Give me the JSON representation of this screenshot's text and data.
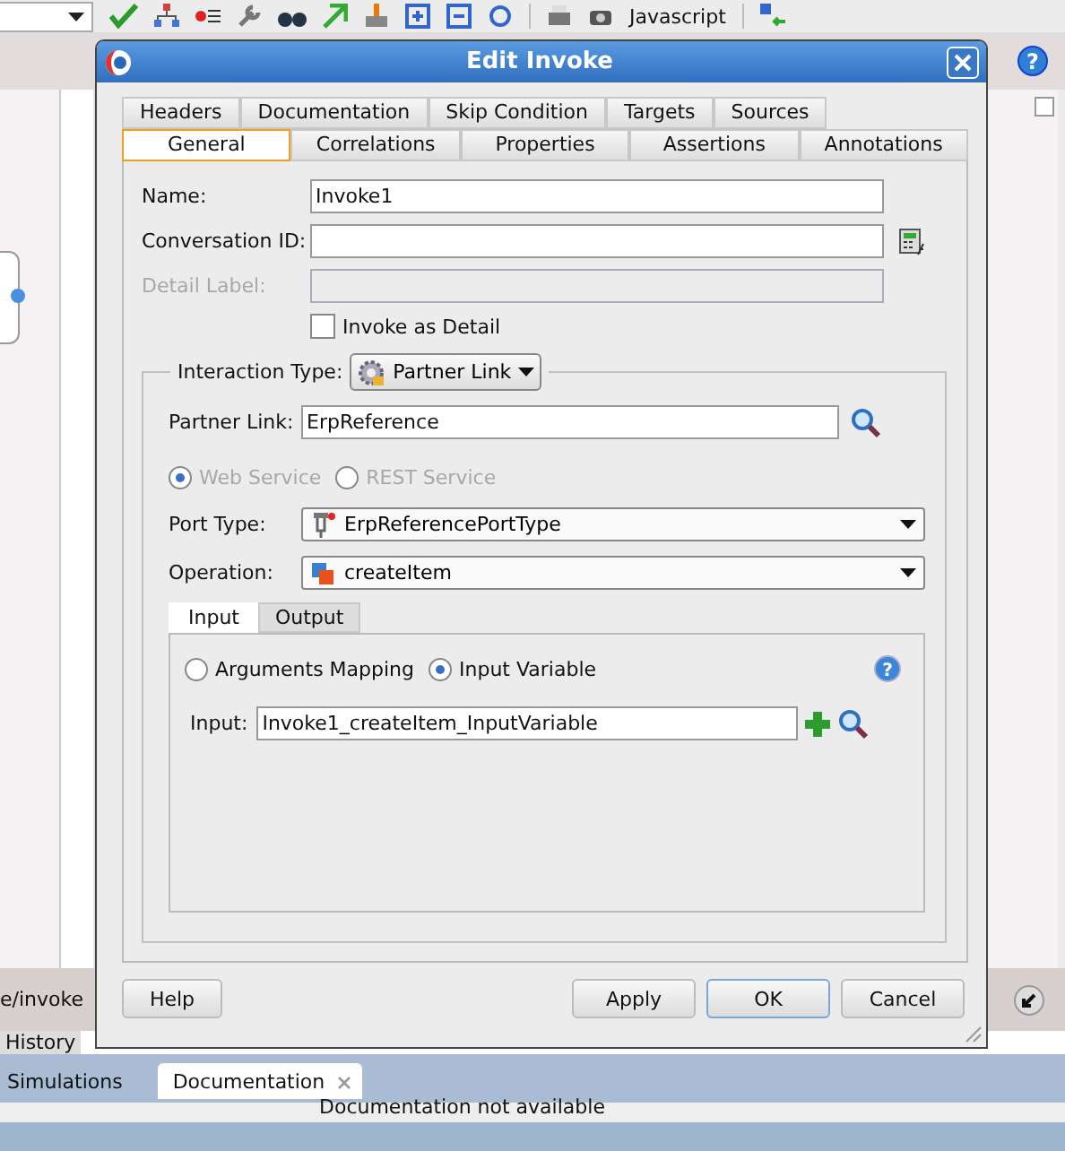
{
  "toolbar": {
    "javascript_label": "Javascript",
    "help_glyph": "?"
  },
  "editor": {
    "breadcrumb": "e/invoke",
    "history_tab": "History"
  },
  "bottom_panel": {
    "tabs": [
      {
        "label": "Simulations",
        "selected": false,
        "closable": false
      },
      {
        "label": "Documentation",
        "selected": true,
        "closable": true
      }
    ],
    "message": "Documentation not available"
  },
  "dialog": {
    "title": "Edit Invoke",
    "tab_rows": [
      [
        {
          "label": "Headers",
          "selected": false
        },
        {
          "label": "Documentation",
          "selected": false
        },
        {
          "label": "Skip Condition",
          "selected": false
        },
        {
          "label": "Targets",
          "selected": false
        },
        {
          "label": "Sources",
          "selected": false
        }
      ],
      [
        {
          "label": "General",
          "selected": true
        },
        {
          "label": "Correlations",
          "selected": false
        },
        {
          "label": "Properties",
          "selected": false
        },
        {
          "label": "Assertions",
          "selected": false
        },
        {
          "label": "Annotations",
          "selected": false
        }
      ]
    ],
    "name": {
      "label": "Name:",
      "value": "Invoke1"
    },
    "conversation_id": {
      "label": "Conversation ID:"
    },
    "detail_label": {
      "label": "Detail Label:",
      "disabled": true
    },
    "invoke_as_detail": {
      "label": "Invoke as Detail",
      "checked": false
    },
    "interaction_type": {
      "label": "Interaction Type:",
      "value": "Partner Link"
    },
    "partner_link": {
      "label": "Partner Link:",
      "value": "ErpReference"
    },
    "service_options": [
      {
        "label": "Web Service",
        "selected": true,
        "disabled": true
      },
      {
        "label": "REST Service",
        "selected": false,
        "disabled": true
      }
    ],
    "port_type": {
      "label": "Port Type:",
      "value": "ErpReferencePortType"
    },
    "operation": {
      "label": "Operation:",
      "value": "createItem"
    },
    "io_tabs": [
      {
        "label": "Input",
        "selected": true
      },
      {
        "label": "Output",
        "selected": false
      }
    ],
    "mapping_options": [
      {
        "label": "Arguments Mapping",
        "selected": false
      },
      {
        "label": "Input Variable",
        "selected": true
      }
    ],
    "help_glyph": "?",
    "input": {
      "label": "Input:",
      "value": "Invoke1_createItem_InputVariable"
    },
    "buttons": [
      {
        "label": "Help",
        "kind": "help"
      },
      {
        "label": "Apply",
        "kind": "normal"
      },
      {
        "label": "OK",
        "kind": "default"
      },
      {
        "label": "Cancel",
        "kind": "normal"
      }
    ]
  }
}
